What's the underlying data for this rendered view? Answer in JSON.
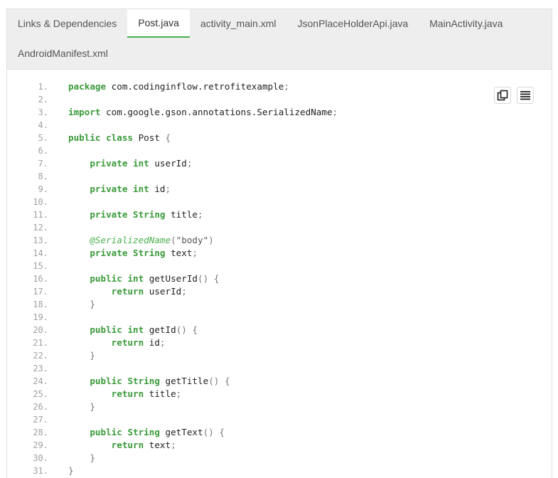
{
  "tabs": [
    {
      "label": "Links & Dependencies"
    },
    {
      "label": "Post.java"
    },
    {
      "label": "activity_main.xml"
    },
    {
      "label": "JsonPlaceHolderApi.java"
    },
    {
      "label": "MainActivity.java"
    },
    {
      "label": "AndroidManifest.xml"
    }
  ],
  "active_tab": "Post.java",
  "toolbar": {
    "copy_icon": "copy-icon",
    "raw_icon": "view-raw-icon"
  },
  "code": {
    "language": "java",
    "lines": [
      {
        "n": "1.",
        "text": "package com.codinginflow.retrofitexample;"
      },
      {
        "n": "2.",
        "text": ""
      },
      {
        "n": "3.",
        "text": "import com.google.gson.annotations.SerializedName;"
      },
      {
        "n": "4.",
        "text": ""
      },
      {
        "n": "5.",
        "text": "public class Post {"
      },
      {
        "n": "6.",
        "text": ""
      },
      {
        "n": "7.",
        "text": "    private int userId;"
      },
      {
        "n": "8.",
        "text": ""
      },
      {
        "n": "9.",
        "text": "    private int id;"
      },
      {
        "n": "10.",
        "text": ""
      },
      {
        "n": "11.",
        "text": "    private String title;"
      },
      {
        "n": "12.",
        "text": ""
      },
      {
        "n": "13.",
        "text": "    @SerializedName(\"body\")"
      },
      {
        "n": "14.",
        "text": "    private String text;"
      },
      {
        "n": "15.",
        "text": ""
      },
      {
        "n": "16.",
        "text": "    public int getUserId() {"
      },
      {
        "n": "17.",
        "text": "        return userId;"
      },
      {
        "n": "18.",
        "text": "    }"
      },
      {
        "n": "19.",
        "text": ""
      },
      {
        "n": "20.",
        "text": "    public int getId() {"
      },
      {
        "n": "21.",
        "text": "        return id;"
      },
      {
        "n": "22.",
        "text": "    }"
      },
      {
        "n": "23.",
        "text": ""
      },
      {
        "n": "24.",
        "text": "    public String getTitle() {"
      },
      {
        "n": "25.",
        "text": "        return title;"
      },
      {
        "n": "26.",
        "text": "    }"
      },
      {
        "n": "27.",
        "text": ""
      },
      {
        "n": "28.",
        "text": "    public String getText() {"
      },
      {
        "n": "29.",
        "text": "        return text;"
      },
      {
        "n": "30.",
        "text": "    }"
      },
      {
        "n": "31.",
        "text": "}"
      }
    ]
  },
  "colors": {
    "keyword": "#3a9a3a",
    "annotation": "#4caf50",
    "active_tab_underline": "#4caf50",
    "tabbar_bg": "#eeeeee"
  }
}
